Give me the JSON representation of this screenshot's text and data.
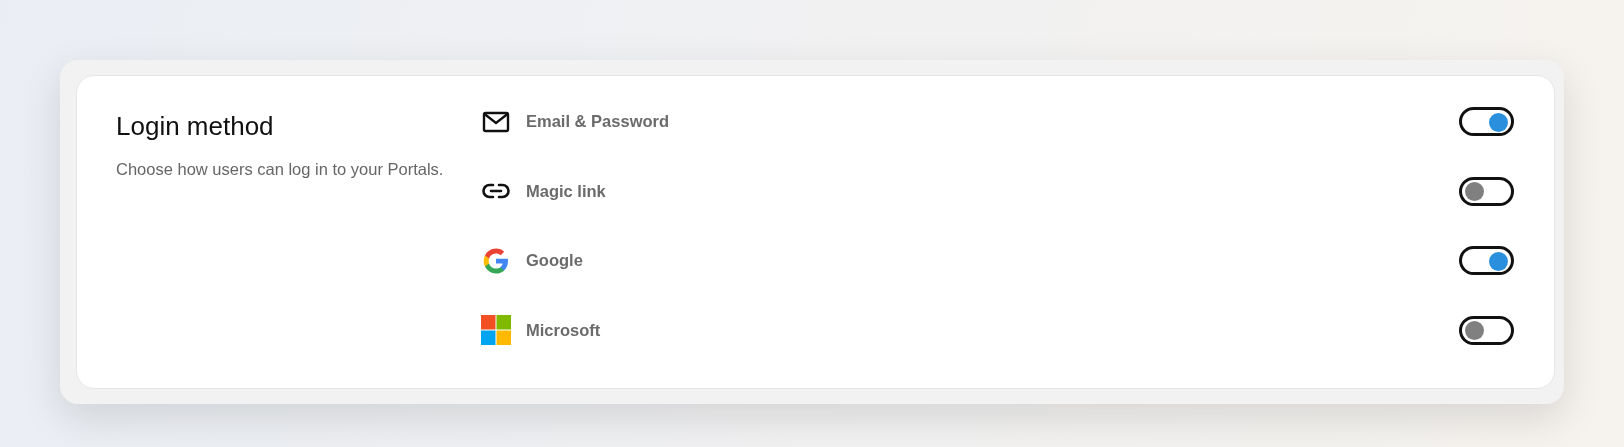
{
  "section": {
    "title": "Login method",
    "description": "Choose how users can log in to your Portals."
  },
  "methods": [
    {
      "kind": "email",
      "label": "Email & Password",
      "on": true
    },
    {
      "kind": "link",
      "label": "Magic link",
      "on": false
    },
    {
      "kind": "google",
      "label": "Google",
      "on": true
    },
    {
      "kind": "microsoft",
      "label": "Microsoft",
      "on": false
    }
  ]
}
